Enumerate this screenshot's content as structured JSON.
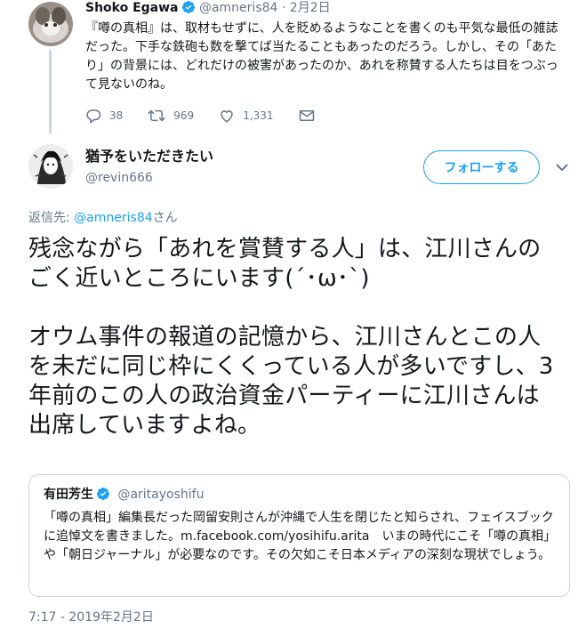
{
  "parent_tweet": {
    "name": "Shoko Egawa",
    "handle": "@amneris84",
    "separator": "·",
    "date": "2月2日",
    "text": "『噂の真相』は、取材もせずに、人を貶めるようなことを書くのも平気な最低の雑誌だった。下手な鉄砲も数を撃てば当たることもあったのだろう。しかし、その「あたり」の背景には、どれだけの被害があったのか、あれを称賛する人たちは目をつぶって見ないのね。",
    "actions": {
      "replies": "38",
      "retweets": "969",
      "likes": "1,331"
    }
  },
  "main_tweet": {
    "name": "猶予をいただきたい",
    "handle": "@revin666",
    "follow_label": "フォローする",
    "reply_prefix": "返信先:",
    "reply_handle": "@amneris84",
    "reply_suffix": "さん",
    "text_paragraph_1": "残念ながら「あれを賞賛する人」は、江川さんのごく近いところにいます(´･ω･`)",
    "text_paragraph_2": "オウム事件の報道の記憶から、江川さんとこの人を未だに同じ枠にくくっている人が多いですし、3年前のこの人の政治資金パーティーに江川さんは出席していますよね。",
    "timestamp": "7:17 - 2019年2月2日"
  },
  "quoted_tweet": {
    "name": "有田芳生",
    "handle": "@aritayoshifu",
    "text": "「噂の真相」編集長だった岡留安則さんが沖縄で人生を閉じたと知らされ、フェイスブックに追悼文を書きました。m.facebook.com/yosihifu.arita　いまの時代にこそ「噂の真相」や「朝日ジャーナル」が必要なのです。その欠如こそ日本メディアの深刻な現状でしょう。"
  },
  "colors": {
    "accent": "#1da1f2",
    "secondary_text": "#657786",
    "border": "#ccd6dd"
  },
  "icons": [
    "verified-badge-icon",
    "reply-icon",
    "retweet-icon",
    "like-icon",
    "direct-message-icon",
    "chevron-down-icon"
  ]
}
